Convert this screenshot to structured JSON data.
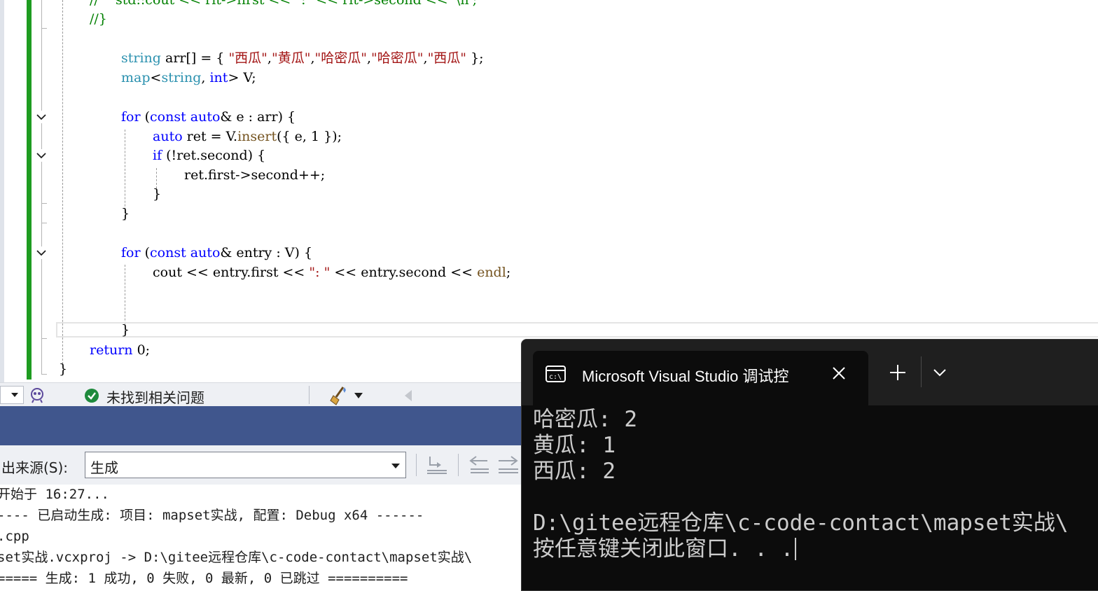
{
  "editor": {
    "lines": {
      "l0": "//    std::cout << rit->first << \":\" << rit->second << '\\n';",
      "l1": "//}",
      "arr_decl": "string arr[] = { \"西瓜\",\"黄瓜\",\"哈密瓜\",\"哈密瓜\",\"西瓜\" };",
      "map_decl": "map<string, int> V;",
      "for1": "for (const auto& e : arr) {",
      "insert": "auto ret = V.insert({ e, 1 });",
      "if_line": "if (!ret.second) {",
      "incr": "ret.first->second++;",
      "close_brace": "}",
      "for2": "for (const auto& entry : V) {",
      "cout": "cout << entry.first << \": \" << entry.second << endl;",
      "return": "return 0;"
    }
  },
  "status": {
    "issues_text": "未找到相关问题"
  },
  "output": {
    "source_label": "出来源(S):",
    "source_value": "生成",
    "lines": [
      "开始于 16:27...",
      "---- 已启动生成: 项目: mapset实战, 配置: Debug x64 ------",
      ".cpp",
      "set实战.vcxproj -> D:\\gitee远程仓库\\c-code-contact\\mapset实战\\",
      "===== 生成: 1 成功, 0 失败, 0 最新, 0 已跳过 =========="
    ]
  },
  "console": {
    "tab_title": "Microsoft Visual Studio 调试控",
    "lines": [
      "哈密瓜: 2",
      "黄瓜: 1",
      "西瓜: 2",
      "",
      "D:\\gitee远程仓库\\c-code-contact\\mapset实战\\",
      "按任意键关闭此窗口. . ."
    ]
  },
  "colors": {
    "keyword": "#0000ff",
    "type": "#2b91af",
    "string": "#a31515",
    "function": "#74531f",
    "change_bar": "#1e9c20",
    "output_header": "#40568d"
  }
}
